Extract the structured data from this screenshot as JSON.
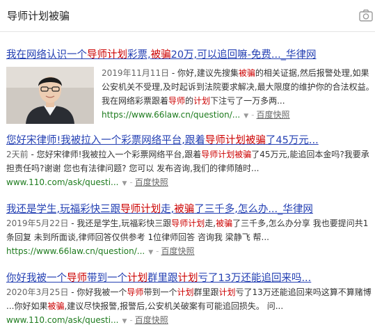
{
  "search": {
    "query": "导师计划被骗"
  },
  "results": [
    {
      "title": [
        {
          "t": "我在网络认识一个",
          "h": false
        },
        {
          "t": "导师计划",
          "h": true
        },
        {
          "t": "彩票,",
          "h": false
        },
        {
          "t": "被骗",
          "h": true
        },
        {
          "t": "20万,可以追回嘛-免费..._华律网",
          "h": false
        }
      ],
      "date": "2019年11月11日",
      "snippet": [
        {
          "t": " - 你好,建议先搜集",
          "h": false
        },
        {
          "t": "被骗",
          "h": true
        },
        {
          "t": "的相关证据,然后报警处理,如果公安机关不受理,及时起诉到法院要求解决,最大限度的维护你的合法权益。我在网络彩票跟着",
          "h": false
        },
        {
          "t": "导师",
          "h": true
        },
        {
          "t": "的",
          "h": false
        },
        {
          "t": "计划",
          "h": true
        },
        {
          "t": "下注亏了一万多两...",
          "h": false
        }
      ],
      "url": "https://www.66law.cn/question/...",
      "cache": "百度快照"
    },
    {
      "title": [
        {
          "t": "您好宋律师!我被拉入一个彩票网络平台,跟着",
          "h": false
        },
        {
          "t": "导师计划被骗",
          "h": true
        },
        {
          "t": "了45万元...",
          "h": false
        }
      ],
      "date": "2天前",
      "snippet": [
        {
          "t": " - 您好宋律师!我被拉入一个彩票网络平台,跟着",
          "h": false
        },
        {
          "t": "导师计划被骗",
          "h": true
        },
        {
          "t": "了45万元,能追回本金吗?我要承担责任吗?谢谢 您也有法律问题? 您可以 发布咨询,我们的律师随时...",
          "h": false
        }
      ],
      "url": "www.110.com/ask/questi...",
      "cache": "百度快照"
    },
    {
      "title": [
        {
          "t": "我还是学生,玩福彩快三跟",
          "h": false
        },
        {
          "t": "导师计划",
          "h": true
        },
        {
          "t": "走,",
          "h": false
        },
        {
          "t": "被骗",
          "h": true
        },
        {
          "t": "了三千多,怎么办..._华律网",
          "h": false
        }
      ],
      "date": "2019年5月22日",
      "snippet": [
        {
          "t": " - 我还是学生,玩福彩快三跟",
          "h": false
        },
        {
          "t": "导师计划",
          "h": true
        },
        {
          "t": "走,",
          "h": false
        },
        {
          "t": "被骗",
          "h": true
        },
        {
          "t": "了三千多,怎么办分享 我也要提问共1 条回复 未到所面谈,律师回答仅供参考 1位律师回答 咨询我 梁静飞 帮...",
          "h": false
        }
      ],
      "url": "https://www.66law.cn/question/...",
      "cache": "百度快照"
    },
    {
      "title": [
        {
          "t": "你好我被一个",
          "h": false
        },
        {
          "t": "导师",
          "h": true
        },
        {
          "t": "带到一个",
          "h": false
        },
        {
          "t": "计划",
          "h": true
        },
        {
          "t": "群里跟",
          "h": false
        },
        {
          "t": "计划",
          "h": true
        },
        {
          "t": "亏了13万还能追回来吗...",
          "h": false
        }
      ],
      "date": "2020年3月25日",
      "snippet": [
        {
          "t": " - 你好我被一个",
          "h": false
        },
        {
          "t": "导师",
          "h": true
        },
        {
          "t": "带到一个",
          "h": false
        },
        {
          "t": "计划",
          "h": true
        },
        {
          "t": "群里跟",
          "h": false
        },
        {
          "t": "计划",
          "h": true
        },
        {
          "t": "亏了13万还能追回来吗这算不算赌博 ...你好如果",
          "h": false
        },
        {
          "t": "被骗",
          "h": true
        },
        {
          "t": ",建议尽快报警,报警后,公安机关破案有可能追回损失。 问...",
          "h": false
        }
      ],
      "url": "www.110.com/ask/questi...",
      "cache": "百度快照"
    }
  ],
  "colors": {
    "link": "#2440b3",
    "highlight": "#cc0000",
    "url": "#1e7b1e"
  },
  "icons": {
    "camera": "camera-icon",
    "dropdown": "chevron-down-icon"
  }
}
